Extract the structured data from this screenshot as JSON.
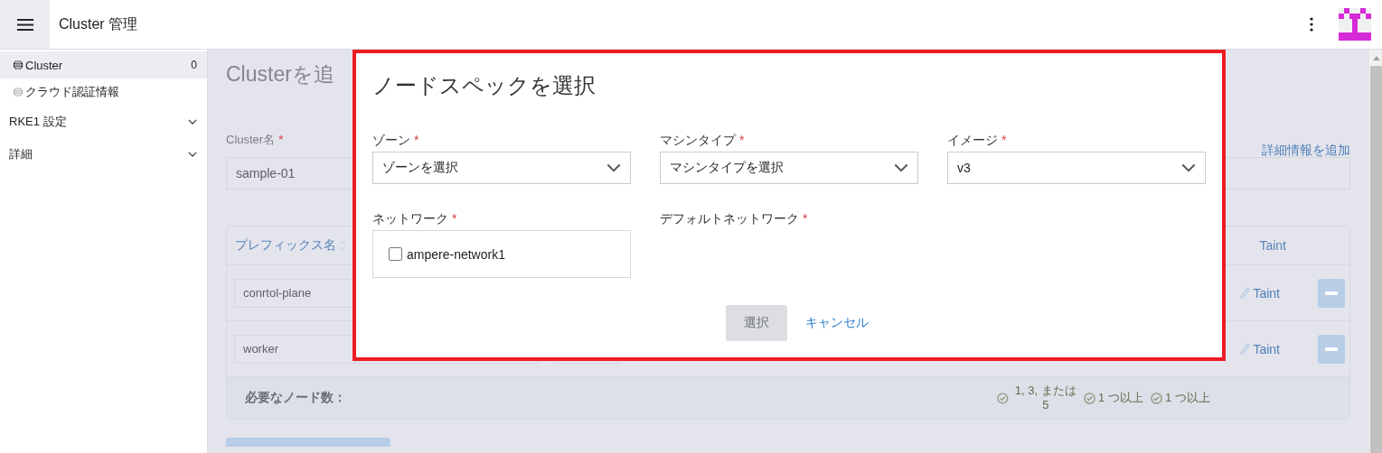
{
  "header": {
    "title": "Cluster 管理"
  },
  "sidebar": {
    "items": [
      {
        "label": "Cluster",
        "count": "0",
        "selected": true
      },
      {
        "label": "クラウド認証情報",
        "selected": false
      }
    ],
    "sections": [
      {
        "label": "RKE1 設定"
      },
      {
        "label": "詳細"
      }
    ]
  },
  "page": {
    "title": "Clusterを追",
    "cluster_name": {
      "label": "Cluster名",
      "mark": "*",
      "value": "sample-01"
    },
    "add_details_link": "詳細情報を追加",
    "table": {
      "prefix_column": "プレフィックス名",
      "taint_column": "Taint",
      "rows": [
        {
          "prefix": "conrtol-plane",
          "taint": "Taint"
        },
        {
          "prefix": "worker",
          "taint": "Taint"
        }
      ],
      "footer": {
        "label": "必要なノード数：",
        "requirements": [
          "1, 3, または 5",
          "1 つ以上",
          "1 つ以上"
        ]
      }
    }
  },
  "modal": {
    "title": "ノードスペックを選択",
    "selects": [
      {
        "label": "ゾーン",
        "mark": "*",
        "value": "ゾーンを選択"
      },
      {
        "label": "マシンタイプ",
        "mark": "*",
        "value": "マシンタイプを選択"
      },
      {
        "label": "イメージ",
        "mark": "*",
        "value": "v3"
      }
    ],
    "network": {
      "label": "ネットワーク",
      "mark": "*",
      "options": [
        {
          "label": "ampere-network1",
          "checked": false
        }
      ]
    },
    "default_network": {
      "label": "デフォルトネットワーク",
      "mark": "*"
    },
    "buttons": [
      {
        "label": "選択",
        "kind": "primary",
        "disabled": true
      },
      {
        "label": "キャンセル",
        "kind": "link",
        "disabled": false
      }
    ]
  }
}
